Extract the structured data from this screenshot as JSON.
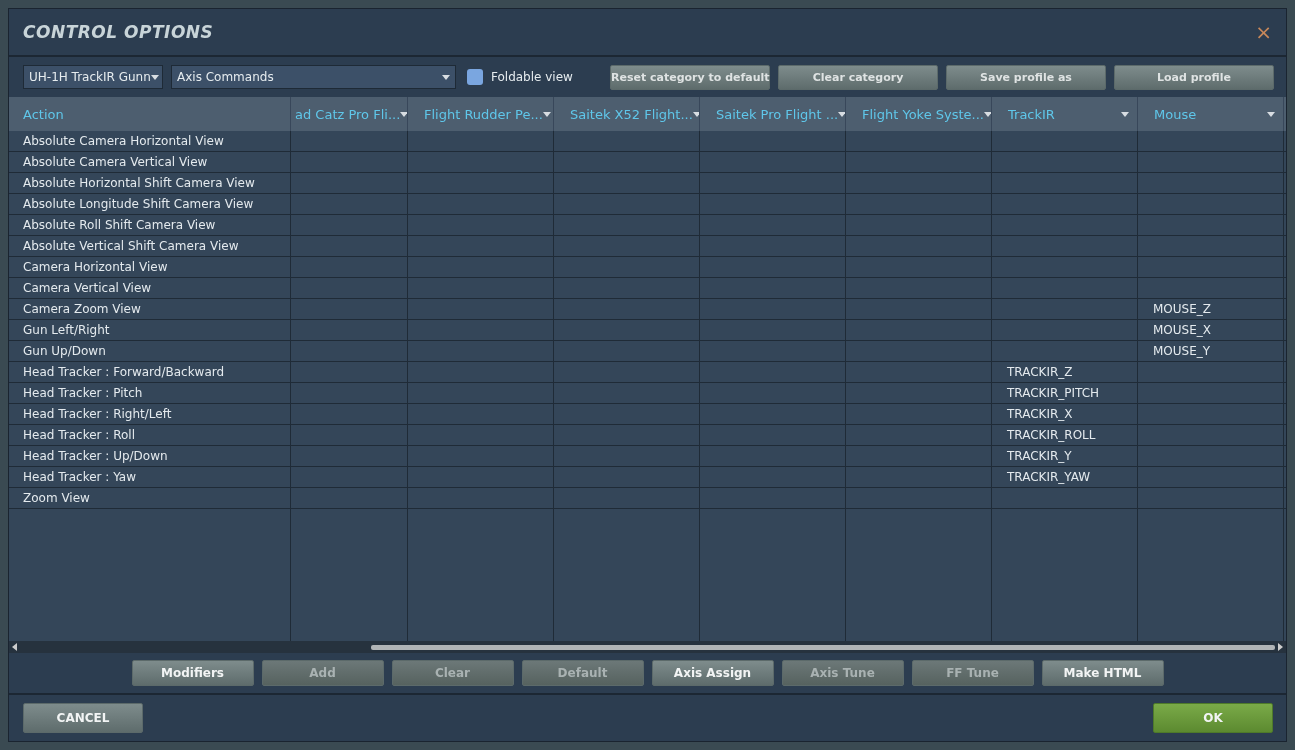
{
  "window": {
    "title": "CONTROL OPTIONS",
    "close": "×"
  },
  "toolbar": {
    "profile": "UH-1H TrackIR Gunn",
    "category": "Axis Commands",
    "foldable_view": {
      "label": "Foldable view",
      "checked": false
    },
    "buttons": [
      {
        "label": "Reset category to default",
        "disabled": false
      },
      {
        "label": "Clear category",
        "disabled": false
      },
      {
        "label": "Save profile as",
        "disabled": false
      },
      {
        "label": "Load profile",
        "disabled": false
      }
    ]
  },
  "table": {
    "columns": [
      "Action",
      "ad Catz Pro Fli...",
      "Flight Rudder Pe...",
      "Saitek X52 Flight...",
      "Saitek Pro Flight ...",
      "Flight Yoke Syste...",
      "TrackIR",
      "Mouse"
    ],
    "rows": [
      {
        "cells": [
          "Absolute Camera Horizontal View",
          "",
          "",
          "",
          "",
          "",
          "",
          ""
        ]
      },
      {
        "cells": [
          "Absolute Camera Vertical View",
          "",
          "",
          "",
          "",
          "",
          "",
          ""
        ]
      },
      {
        "cells": [
          "Absolute Horizontal Shift Camera View",
          "",
          "",
          "",
          "",
          "",
          "",
          ""
        ]
      },
      {
        "cells": [
          "Absolute Longitude Shift Camera View",
          "",
          "",
          "",
          "",
          "",
          "",
          ""
        ]
      },
      {
        "cells": [
          "Absolute Roll Shift Camera View",
          "",
          "",
          "",
          "",
          "",
          "",
          ""
        ]
      },
      {
        "cells": [
          "Absolute Vertical Shift Camera View",
          "",
          "",
          "",
          "",
          "",
          "",
          ""
        ]
      },
      {
        "cells": [
          "Camera Horizontal View",
          "",
          "",
          "",
          "",
          "",
          "",
          ""
        ]
      },
      {
        "cells": [
          "Camera Vertical View",
          "",
          "",
          "",
          "",
          "",
          "",
          ""
        ]
      },
      {
        "cells": [
          "Camera Zoom View",
          "",
          "",
          "",
          "",
          "",
          "",
          "MOUSE_Z"
        ]
      },
      {
        "cells": [
          "Gun Left/Right",
          "",
          "",
          "",
          "",
          "",
          "",
          "MOUSE_X"
        ]
      },
      {
        "cells": [
          "Gun Up/Down",
          "",
          "",
          "",
          "",
          "",
          "",
          "MOUSE_Y"
        ]
      },
      {
        "cells": [
          "Head Tracker : Forward/Backward",
          "",
          "",
          "",
          "",
          "",
          "TRACKIR_Z",
          ""
        ]
      },
      {
        "cells": [
          "Head Tracker : Pitch",
          "",
          "",
          "",
          "",
          "",
          "TRACKIR_PITCH",
          ""
        ]
      },
      {
        "cells": [
          "Head Tracker : Right/Left",
          "",
          "",
          "",
          "",
          "",
          "TRACKIR_X",
          ""
        ]
      },
      {
        "cells": [
          "Head Tracker : Roll",
          "",
          "",
          "",
          "",
          "",
          "TRACKIR_ROLL",
          ""
        ]
      },
      {
        "cells": [
          "Head Tracker : Up/Down",
          "",
          "",
          "",
          "",
          "",
          "TRACKIR_Y",
          ""
        ]
      },
      {
        "cells": [
          "Head Tracker : Yaw",
          "",
          "",
          "",
          "",
          "",
          "TRACKIR_YAW",
          ""
        ]
      },
      {
        "cells": [
          "Zoom View",
          "",
          "",
          "",
          "",
          "",
          "",
          ""
        ]
      }
    ]
  },
  "actions": [
    {
      "label": "Modifiers",
      "disabled": false
    },
    {
      "label": "Add",
      "disabled": true
    },
    {
      "label": "Clear",
      "disabled": true
    },
    {
      "label": "Default",
      "disabled": true
    },
    {
      "label": "Axis Assign",
      "disabled": false
    },
    {
      "label": "Axis Tune",
      "disabled": true
    },
    {
      "label": "FF Tune",
      "disabled": true
    },
    {
      "label": "Make HTML",
      "disabled": false
    }
  ],
  "footer": {
    "cancel": "CANCEL",
    "ok": "OK"
  }
}
